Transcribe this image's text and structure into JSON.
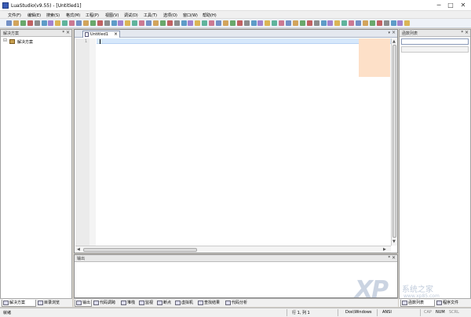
{
  "window": {
    "title": "LuaStudio(v9.55) - [Untitled1]",
    "min": "─",
    "max": "□",
    "close": "✕"
  },
  "menu": [
    "文件(F)",
    "编辑(E)",
    "搜索(S)",
    "格式(M)",
    "工程(P)",
    "视图(V)",
    "调试(D)",
    "工具(T)",
    "选项(O)",
    "窗口(W)",
    "帮助(H)"
  ],
  "left_panel": {
    "title": "解决方案",
    "pin": "ᵠ",
    "close": "×",
    "tree_expander": "⊟",
    "tree_item": "解决方案",
    "tabs": [
      "解决方案",
      "目录浏览"
    ]
  },
  "editor": {
    "tab_label": "Untitled1",
    "tab_close": "×",
    "menu_arrow": "▾",
    "close": "×",
    "line_number": "1"
  },
  "output_panel": {
    "title": "输出",
    "pin": "ᵠ",
    "close": "×"
  },
  "bottom_tabs": [
    "输出",
    "代码调跨",
    "堆栈",
    "监视",
    "断点",
    "虚拟机",
    "查找结果",
    "代码分析"
  ],
  "right_panel": {
    "title": "函数列表",
    "pin": "ᵠ",
    "close": "×",
    "tabs": [
      "函数列表",
      "程序文件"
    ]
  },
  "status": {
    "ready": "就绪",
    "position": "行 1, 列 1",
    "line_ending": "Dos\\Windows",
    "encoding": "ANSI",
    "cap": "CAP",
    "num": "NUM",
    "scrl": "SCRL"
  },
  "watermark": {
    "brand": "XP",
    "cn": "系统之家",
    "url": "www.xp85.com"
  },
  "toolbar_colors": [
    "#4a6fb5",
    "#c88a2a",
    "#3c8f3c",
    "#b03030",
    "#6a6a6a",
    "#2c7fb8",
    "#8a5cc0",
    "#d4a020",
    "#2f9f7f",
    "#c05070"
  ]
}
